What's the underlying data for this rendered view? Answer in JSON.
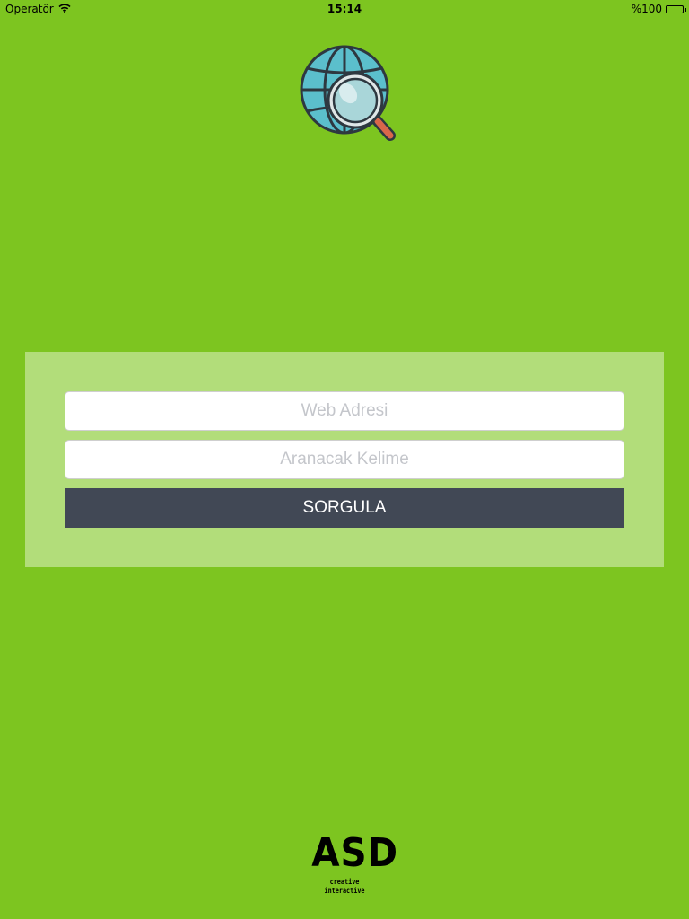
{
  "status_bar": {
    "carrier": "Operatör",
    "time": "15:14",
    "battery_percent": "%100",
    "battery_level": 1.0
  },
  "app": {
    "logo_icon": "globe-search-icon"
  },
  "form": {
    "web_address_placeholder": "Web Adresi",
    "web_address_value": "",
    "keyword_placeholder": "Aranacak Kelime",
    "keyword_value": "",
    "submit_label": "SORGULA"
  },
  "footer": {
    "brand_name": "ASD",
    "brand_tagline": "creative interactive"
  },
  "colors": {
    "background": "#7dc520",
    "panel": "#b2dd7a",
    "button": "#414855",
    "button_text": "#ffffff",
    "placeholder": "#c4c6cb"
  }
}
